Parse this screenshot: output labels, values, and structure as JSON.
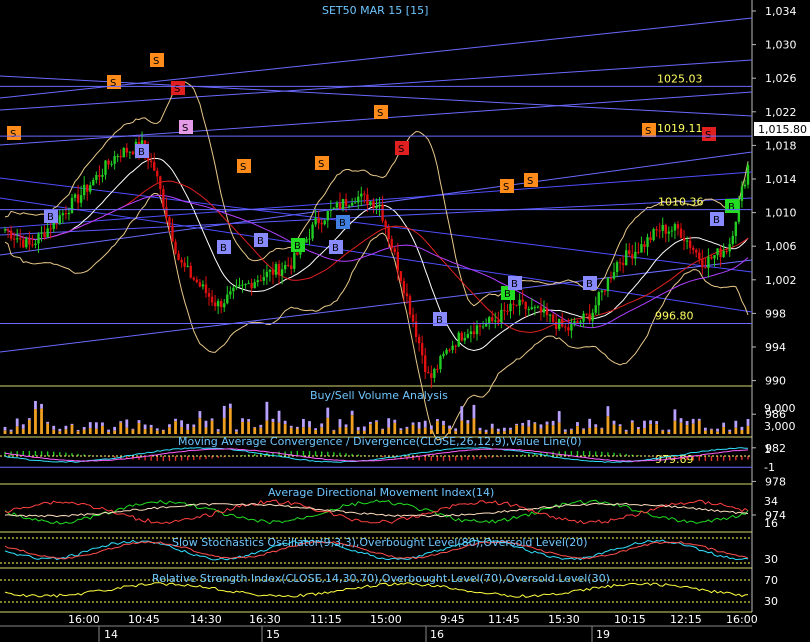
{
  "title": "SET50 MAR 15   [15]",
  "last_price": "1,015.80",
  "price_axis": [
    "1,034",
    "1,030",
    "1,026",
    "1,022",
    "1,018",
    "1,014",
    "1,010",
    "1,006",
    "1,002",
    "998",
    "994",
    "990",
    "986",
    "982",
    "978",
    "974"
  ],
  "price_axis_values": [
    1034,
    1030,
    1026,
    1022,
    1018,
    1014,
    1010,
    1006,
    1002,
    998,
    994,
    990,
    986,
    982,
    978,
    974
  ],
  "levels": [
    {
      "label": "1025.03",
      "value": 1025.03
    },
    {
      "label": "1019.11",
      "value": 1019.11
    },
    {
      "label": "1010.36",
      "value": 1010.36
    },
    {
      "label": "996.80",
      "value": 996.8
    },
    {
      "label": "979.69",
      "value": 979.69
    }
  ],
  "panels": {
    "volume": {
      "title": "Buy/Sell Volume Analysis",
      "ticks": [
        "9,000",
        "3,000"
      ]
    },
    "macd": {
      "title": "Moving Average Convergence / Divergence(CLOSE,26,12,9),Value Line(0)",
      "ticks": [
        "1",
        "-1"
      ]
    },
    "adx": {
      "title": "Average Directional Movement Index(14)",
      "ticks": [
        "34",
        "16"
      ]
    },
    "stoch": {
      "title": "Slow Stochastics Oscillator(9,3,3),Overbought Level(80),Oversold Level(20)",
      "ticks": [
        "30"
      ]
    },
    "rsi": {
      "title": "Relative Strength Index(CLOSE,14,30,70),Overbought Level(70),Oversold Level(30)",
      "ticks": [
        "70",
        "30"
      ]
    }
  },
  "time_axis": [
    "16:00",
    "10:45",
    "14:30",
    "16:30",
    "11:15",
    "15:00",
    "9:45",
    "11:45",
    "15:30",
    "10:15",
    "12:15",
    "16:00"
  ],
  "date_axis": [
    "14",
    "15",
    "16",
    "19"
  ],
  "colors": {
    "up": "#22cc22",
    "down": "#e01010",
    "vol_buy": "#f0a020",
    "vol_sell": "#b8a0ff",
    "sig_s": "#ff8c1a",
    "sig_b": "#8a8aff",
    "sig_sell_red": "#e02020",
    "sig_buy_green": "#22dd22"
  }
}
